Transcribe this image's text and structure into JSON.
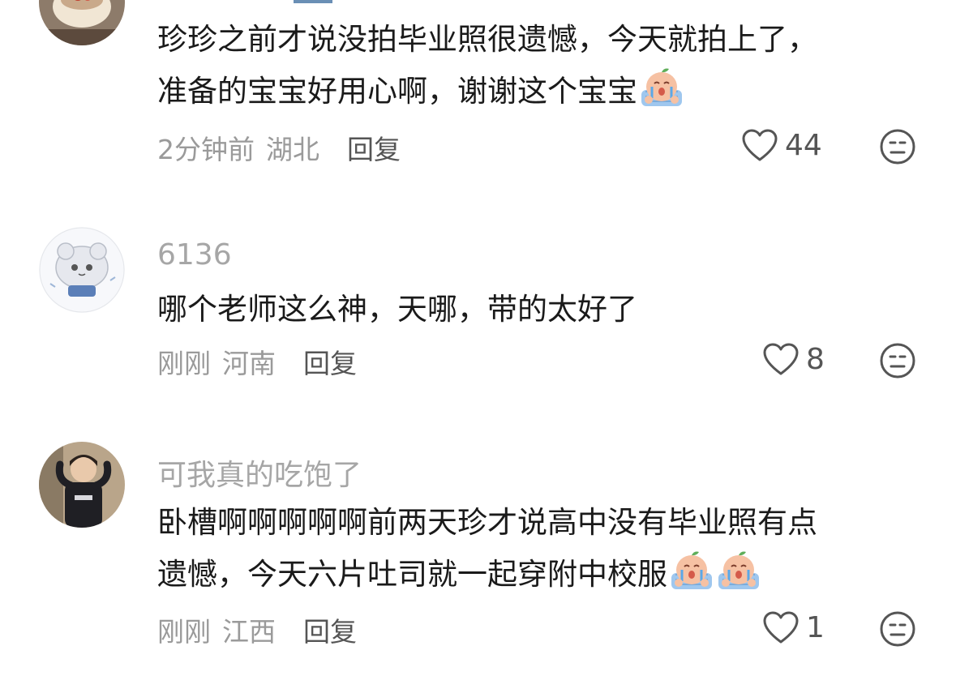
{
  "comments": [
    {
      "username": "",
      "text_lines": [
        "珍珍之前才说没拍毕业照很遗憾，今天就拍上了，",
        "准备的宝宝好用心啊，谢谢这个宝宝"
      ],
      "emoji_count": 1,
      "time": "2分钟前",
      "location": "湖北",
      "reply_label": "回复",
      "likes": "44"
    },
    {
      "username": "6136",
      "text_lines": [
        "哪个老师这么神，天哪，带的太好了"
      ],
      "emoji_count": 0,
      "time": "刚刚",
      "location": "河南",
      "reply_label": "回复",
      "likes": "8"
    },
    {
      "username": "可我真的吃饱了",
      "text_lines": [
        "卧槽啊啊啊啊啊前两天珍才说高中没有毕业照有点",
        "遗憾，今天六片吐司就一起穿附中校服"
      ],
      "emoji_count": 2,
      "time": "刚刚",
      "location": "江西",
      "reply_label": "回复",
      "likes": "1"
    }
  ],
  "icons": {
    "like": "heart-outline-icon",
    "dislike": "meh-face-icon",
    "emoji": "crying-peach-emoji"
  }
}
